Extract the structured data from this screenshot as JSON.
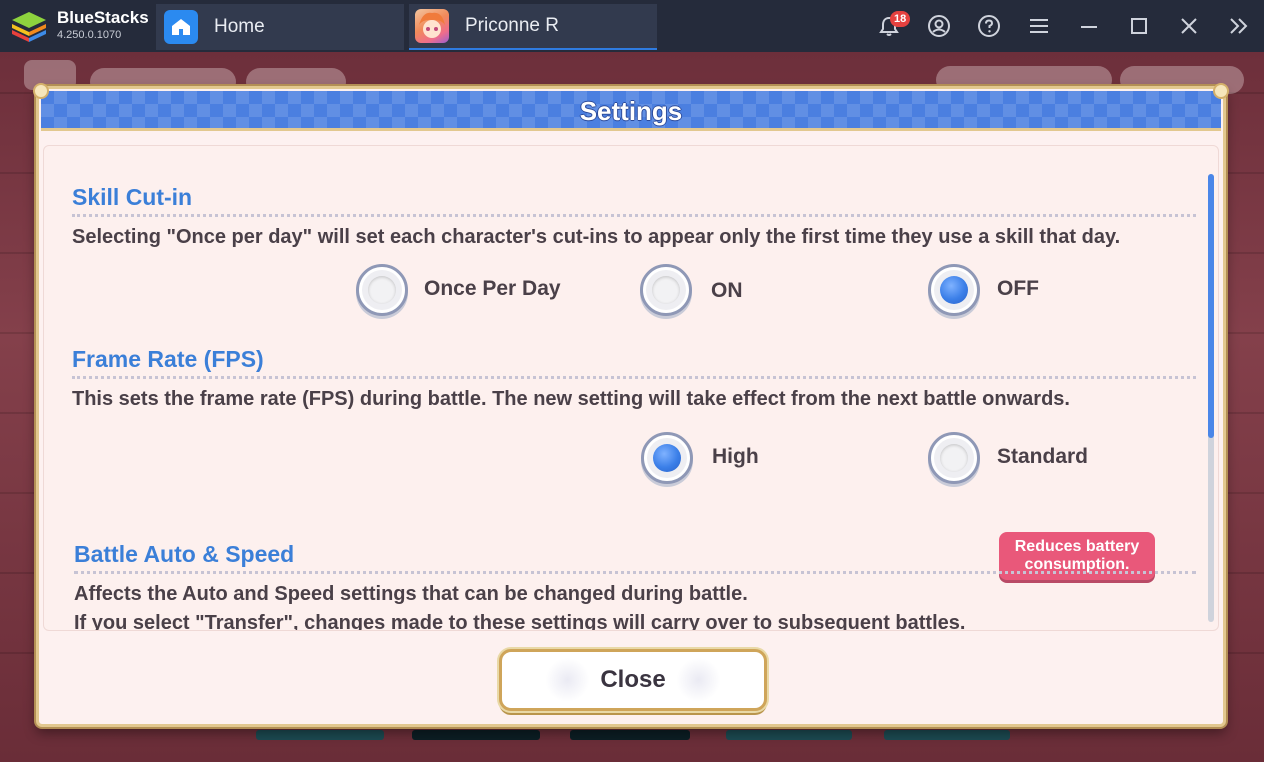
{
  "app": {
    "name": "BlueStacks",
    "version": "4.250.0.1070",
    "tabs": [
      {
        "label": "Home"
      },
      {
        "label": "Priconne R"
      }
    ],
    "notification_count": "18",
    "toolbar_icons": [
      "bell-icon",
      "account-icon",
      "help-icon",
      "menu-icon",
      "minimize-icon",
      "maximize-icon",
      "close-icon",
      "expand-sidebar-icon"
    ]
  },
  "dialog": {
    "title": "Settings",
    "sections": [
      {
        "title": "Skill Cut-in",
        "description": "Selecting \"Once per day\" will set each character's cut-ins to appear only the first time they use a skill that day.",
        "options": [
          {
            "label": "Once Per Day",
            "selected": false
          },
          {
            "label": "ON",
            "selected": false
          },
          {
            "label": "OFF",
            "selected": true
          }
        ]
      },
      {
        "title": "Frame Rate (FPS)",
        "description": "This sets the frame rate (FPS) during battle. The new setting will take effect from the next battle onwards.",
        "options": [
          {
            "label": "High",
            "selected": true
          },
          {
            "label": "Standard",
            "selected": false
          }
        ],
        "note": "Reduces battery consumption."
      },
      {
        "title": "Battle Auto & Speed",
        "description_lines": [
          "Affects the Auto and Speed settings that can be changed during battle.",
          "If you select \"Transfer\", changes made to these settings will carry over to subsequent battles."
        ]
      }
    ],
    "close_label": "Close"
  },
  "colors": {
    "accent_blue": "#3b7fd8",
    "header_blue": "#4b7fe0",
    "note_pink": "#e9587a",
    "gold_border": "#e2c88f"
  }
}
